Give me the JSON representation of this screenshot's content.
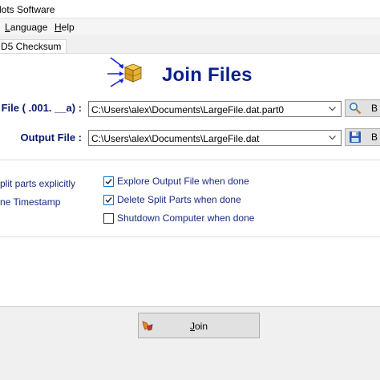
{
  "window": {
    "title": "lots Software"
  },
  "menu": [
    {
      "label": "Language",
      "mnemonic": "L",
      "rest": "anguage"
    },
    {
      "label": "Help",
      "mnemonic": "H",
      "rest": "elp"
    }
  ],
  "tabs": [
    {
      "label": "D5 Checksum"
    }
  ],
  "heading": {
    "title": "Join Files"
  },
  "input_file": {
    "label": "File ( .001. __a) :",
    "value": "C:\\Users\\alex\\Documents\\LargeFile.dat.part0",
    "browse_label": "B"
  },
  "output_file": {
    "label": "Output File :",
    "value": "C:\\Users\\alex\\Documents\\LargeFile.dat",
    "browse_label": "B"
  },
  "left_options": {
    "split_parts_text": "plit parts explicitly",
    "timestamp_text": "ne Timestamp"
  },
  "options": [
    {
      "label": "Explore Output File when done",
      "checked": true
    },
    {
      "label": "Delete Split Parts when done",
      "checked": true
    },
    {
      "label": "Shutdown Computer when done",
      "checked": false
    }
  ],
  "join_button": {
    "mnemonic": "J",
    "rest": "oin"
  },
  "colors": {
    "heading": "#0a1f8f",
    "label": "#0b1a6e",
    "checkbox_accent": "#0078d7"
  }
}
